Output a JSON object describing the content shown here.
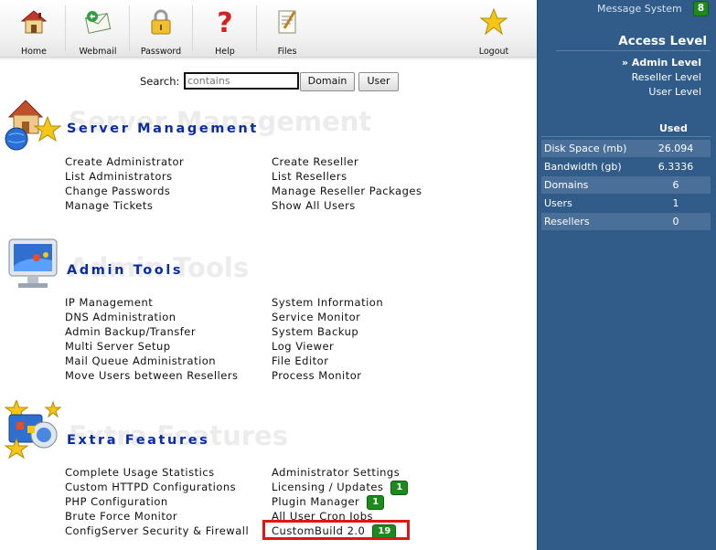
{
  "toolbar": {
    "items": [
      {
        "label": "Home",
        "icon": "home-icon"
      },
      {
        "label": "Webmail",
        "icon": "mail-icon"
      },
      {
        "label": "Password",
        "icon": "lock-icon"
      },
      {
        "label": "Help",
        "icon": "question-icon"
      },
      {
        "label": "Files",
        "icon": "files-icon"
      },
      {
        "label": "Logout",
        "icon": "star-icon"
      }
    ]
  },
  "search": {
    "label": "Search:",
    "placeholder": "contains",
    "domain_button": "Domain",
    "user_button": "User"
  },
  "sections": [
    {
      "title": "Server Management",
      "ghost": "Server Management",
      "icon": "server-house-globe-icon",
      "left": [
        "Create Administrator",
        "List Administrators",
        "Change Passwords",
        "Manage Tickets"
      ],
      "right": [
        "Create Reseller",
        "List Resellers",
        "Manage Reseller Packages",
        "Show All Users"
      ]
    },
    {
      "title": "Admin Tools",
      "ghost": "Admin Tools",
      "icon": "monitor-tools-icon",
      "left": [
        "IP Management",
        "DNS Administration",
        "Admin Backup/Transfer",
        "Multi Server Setup",
        "Mail Queue Administration",
        "Move Users between Resellers"
      ],
      "right": [
        "System Information",
        "Service Monitor",
        "System Backup",
        "Log Viewer",
        "File Editor",
        "Process Monitor"
      ]
    },
    {
      "title": "Extra Features",
      "ghost": "Extra Features",
      "icon": "extra-features-icon",
      "left": [
        "Complete Usage Statistics",
        "Custom HTTPD Configurations",
        "PHP Configuration",
        "Brute Force Monitor",
        "ConfigServer Security & Firewall"
      ],
      "right": [
        "Administrator Settings",
        "Licensing / Updates",
        "Plugin Manager",
        "All User Cron Jobs",
        "CustomBuild 2.0"
      ],
      "right_badges": [
        "",
        "1",
        "1",
        "",
        "19"
      ]
    }
  ],
  "panel": {
    "message_label": "Message System",
    "message_count": "8",
    "access_title": "Access Level",
    "levels": [
      "» Admin Level",
      "Reseller Level",
      "User Level"
    ],
    "used_header": "Used",
    "stats": [
      {
        "label": "Disk Space (mb)",
        "value": "26.094"
      },
      {
        "label": "Bandwidth (gb)",
        "value": "6.3336"
      },
      {
        "label": "Domains",
        "value": "6"
      },
      {
        "label": "Users",
        "value": "1"
      },
      {
        "label": "Resellers",
        "value": "0"
      }
    ]
  },
  "colors": {
    "panel_bg": "#315c8a",
    "section_title": "#0a2d9e",
    "badge_green": "#1d8a1d",
    "highlight_red": "#e01515"
  }
}
